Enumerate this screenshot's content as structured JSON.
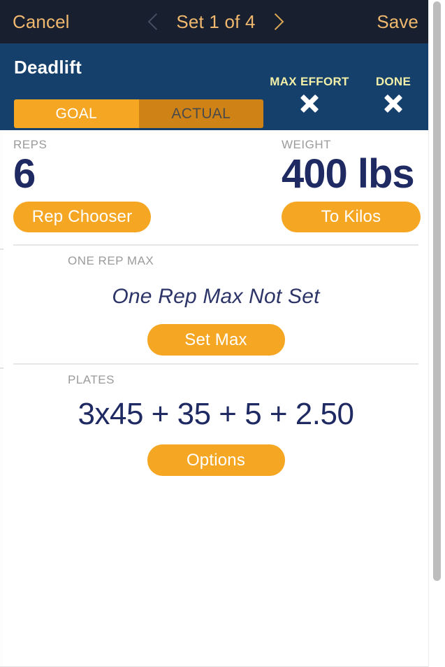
{
  "navbar": {
    "cancel_label": "Cancel",
    "prev_icon": "chevron-left-icon",
    "title": "Set 1 of 4",
    "next_icon": "chevron-right-icon",
    "save_label": "Save"
  },
  "exercise_header": {
    "name": "Deadlift",
    "flags": [
      {
        "label": "MAX EFFORT",
        "icon": "x-mark-icon",
        "state": "off"
      },
      {
        "label": "DONE",
        "icon": "x-mark-icon",
        "state": "off"
      }
    ],
    "segmented": {
      "options": [
        "GOAL",
        "ACTUAL"
      ],
      "selected": "GOAL"
    }
  },
  "metrics": {
    "reps": {
      "label": "REPS",
      "value": "6",
      "button": "Rep Chooser"
    },
    "weight": {
      "label": "WEIGHT",
      "value": "400 lbs",
      "button": "To Kilos"
    }
  },
  "one_rep_max": {
    "label": "ONE REP MAX",
    "status": "One Rep Max Not Set",
    "button": "Set Max"
  },
  "plates": {
    "label": "PLATES",
    "value": "3x45 + 35 + 5 + 2.50",
    "button": "Options"
  },
  "colors": {
    "navbar_bg": "#181f2e",
    "header_bg": "#15406b",
    "accent_orange": "#f5a623",
    "accent_orange_dark": "#cf8316",
    "nav_text": "#f0b86e",
    "value_navy": "#1f2a63",
    "flag_yellow": "#f2efa8",
    "label_gray": "#9b9b9b"
  }
}
